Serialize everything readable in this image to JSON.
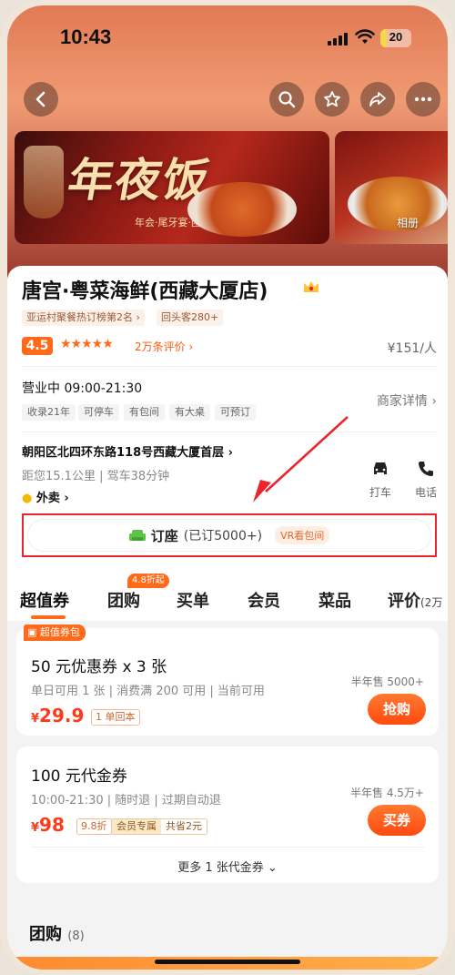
{
  "status_bar": {
    "time": "10:43",
    "battery": "20",
    "battery_level": 0.2
  },
  "gallery": {
    "banner_text": "年夜饭",
    "banner_sub": "年会·尾牙宴·团圆宴",
    "album_label": "相册"
  },
  "shop": {
    "name": "唐宫·粤菜海鲜(西藏大厦店)",
    "rank_tag": "亚运村聚餐热订榜第2名",
    "repeat_tag": "回头客280+",
    "rating": "4.5",
    "stars": "★★★★★",
    "review_count": "2万条评价",
    "avg_price": "¥151/人",
    "status_hours": "营业中 09:00-21:30",
    "features": [
      "收录21年",
      "可停车",
      "有包间",
      "有大桌",
      "可预订"
    ],
    "details_link": "商家详情",
    "address": "朝阳区北四环东路118号西藏大厦首层",
    "distance": "距您15.1公里",
    "drive": "驾车38分钟",
    "delivery": "外卖",
    "taxi_label": "打车",
    "phone_label": "电话"
  },
  "booking": {
    "label": "订座",
    "count": "(已订5000+)",
    "vr_label": "VR看包间"
  },
  "tabs": [
    {
      "label": "超值券"
    },
    {
      "label": "团购",
      "badge": "4.8折起"
    },
    {
      "label": "买单"
    },
    {
      "label": "会员"
    },
    {
      "label": "菜品"
    },
    {
      "label": "评价",
      "sub": "(2万"
    }
  ],
  "vouchers": [
    {
      "pack_label": "超值券包",
      "name": "50 元优惠券 x 3 张",
      "rules": "单日可用 1 张 | 消费满 200 可用 | 当前可用",
      "currency": "¥",
      "price": "29.9",
      "tag": "1 单回本",
      "sold": "半年售 5000+",
      "button": "抢购"
    },
    {
      "name": "100 元代金券",
      "rules": "10:00-21:30 | 随时退 | 过期自动退",
      "currency": "¥",
      "price": "98",
      "discount": "9.8折",
      "member_tag": "会员专属",
      "save_tag": "共省2元",
      "sold": "半年售 4.5万+",
      "button": "买券",
      "more": "更多 1 张代金券"
    }
  ],
  "group_section": {
    "title": "团购",
    "count": "(8)"
  },
  "colors": {
    "accent": "#ff6a1a",
    "highlight_box": "#e8262c",
    "price": "#ff3a1a"
  }
}
